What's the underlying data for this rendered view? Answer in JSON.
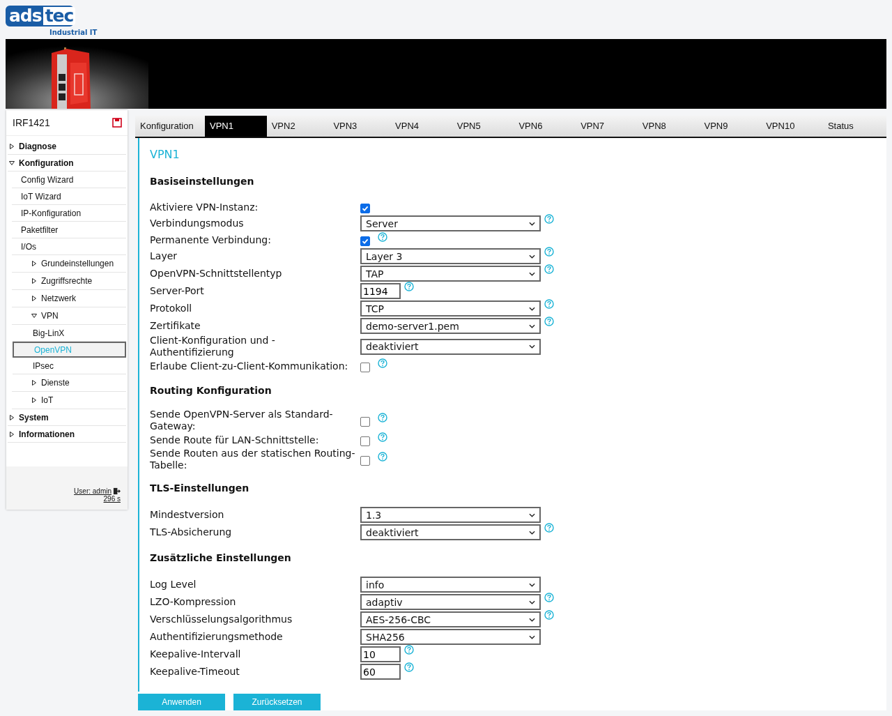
{
  "logo": {
    "mark_left": "ads",
    "mark_right": "tec",
    "tagline": "Industrial IT"
  },
  "banner": {
    "kind": "picture"
  },
  "sidebar": {
    "device": "IRF1421",
    "items": [
      {
        "label": "Diagnose",
        "expanded": false,
        "selected": false
      },
      {
        "label": "Konfiguration",
        "expanded": true,
        "selected": false,
        "children": [
          {
            "label": "Config Wizard",
            "selected": false
          },
          {
            "label": "IoT Wizard",
            "selected": false
          },
          {
            "label": "IP-Konfiguration",
            "selected": false
          },
          {
            "label": "Paketfilter",
            "selected": false
          },
          {
            "label": "I/Os",
            "selected": false
          },
          {
            "label": "Grundeinstellungen",
            "expanded": false,
            "selected": false
          },
          {
            "label": "Zugriffsrechte",
            "expanded": false,
            "selected": false
          },
          {
            "label": "Netzwerk",
            "expanded": false,
            "selected": false
          },
          {
            "label": "VPN",
            "expanded": true,
            "selected": false,
            "children": [
              {
                "label": "Big-LinX",
                "selected": false
              },
              {
                "label": "OpenVPN",
                "selected": true
              },
              {
                "label": "IPsec",
                "selected": false
              }
            ]
          },
          {
            "label": "Dienste",
            "expanded": false,
            "selected": false
          },
          {
            "label": "IoT",
            "expanded": false,
            "selected": false
          }
        ]
      },
      {
        "label": "System",
        "expanded": false,
        "selected": false
      },
      {
        "label": "Informationen",
        "expanded": false,
        "selected": false
      }
    ],
    "user": "User: admin",
    "timer": "296 s"
  },
  "tabs": [
    {
      "label": "Konfiguration",
      "selected": false
    },
    {
      "label": "VPN1",
      "selected": true
    },
    {
      "label": "VPN2",
      "selected": false
    },
    {
      "label": "VPN3",
      "selected": false
    },
    {
      "label": "VPN4",
      "selected": false
    },
    {
      "label": "VPN5",
      "selected": false
    },
    {
      "label": "VPN6",
      "selected": false
    },
    {
      "label": "VPN7",
      "selected": false
    },
    {
      "label": "VPN8",
      "selected": false
    },
    {
      "label": "VPN9",
      "selected": false
    },
    {
      "label": "VPN10",
      "selected": false
    },
    {
      "label": "Status",
      "selected": false
    }
  ],
  "page_title": "VPN1",
  "sections": [
    {
      "title": "Basiseinstellungen",
      "fields": [
        {
          "label": "Aktiviere VPN-Instanz:",
          "kind": "checkbox",
          "checked": true,
          "help": false
        },
        {
          "label": "Verbindungsmodus",
          "kind": "select",
          "value": "Server",
          "help": true
        },
        {
          "label": "Permanente Verbindung:",
          "kind": "checkbox",
          "checked": true,
          "help": true
        },
        {
          "label": "Layer",
          "kind": "select",
          "value": "Layer 3",
          "help": true
        },
        {
          "label": "OpenVPN-Schnittstellentyp",
          "kind": "select",
          "value": "TAP",
          "help": true
        },
        {
          "label": "Server-Port",
          "kind": "text",
          "value": "1194",
          "help": true
        },
        {
          "label": "Protokoll",
          "kind": "select",
          "value": "TCP",
          "help": true
        },
        {
          "label": "Zertifikate",
          "kind": "select",
          "value": "demo-server1.pem",
          "help": true
        },
        {
          "label": "Client-Konfiguration und -Authentifizierung",
          "kind": "select",
          "value": "deaktiviert",
          "help": false
        },
        {
          "label": "Erlaube Client-zu-Client-Kommunikation:",
          "kind": "checkbox",
          "checked": false,
          "help": true
        }
      ]
    },
    {
      "title": "Routing Konfiguration",
      "fields": [
        {
          "label": "Sende OpenVPN-Server als Standard-Gateway:",
          "kind": "checkbox",
          "checked": false,
          "help": true
        },
        {
          "label": "Sende Route für LAN-Schnittstelle:",
          "kind": "checkbox",
          "checked": false,
          "help": true
        },
        {
          "label": "Sende Routen aus der statischen Routing-Tabelle:",
          "kind": "checkbox",
          "checked": false,
          "help": true
        }
      ]
    },
    {
      "title": "TLS-Einstellungen",
      "fields": [
        {
          "label": "Mindestversion",
          "kind": "select",
          "value": "1.3",
          "help": false
        },
        {
          "label": "TLS-Absicherung",
          "kind": "select",
          "value": "deaktiviert",
          "help": true
        }
      ]
    },
    {
      "title": "Zusätzliche Einstellungen",
      "fields": [
        {
          "label": "Log Level",
          "kind": "select",
          "value": "info",
          "help": false
        },
        {
          "label": "LZO-Kompression",
          "kind": "select",
          "value": "adaptiv",
          "help": true
        },
        {
          "label": "Verschlüsselungsalgorithmus",
          "kind": "select",
          "value": "AES-256-CBC",
          "help": true
        },
        {
          "label": "Authentifizierungsmethode",
          "kind": "select",
          "value": "SHA256",
          "help": false
        },
        {
          "label": "Keepalive-Intervall",
          "kind": "text",
          "value": "10",
          "help": true
        },
        {
          "label": "Keepalive-Timeout",
          "kind": "text",
          "value": "60",
          "help": true
        }
      ]
    }
  ],
  "buttons": [
    "Anwenden",
    "Zurücksetzen"
  ]
}
